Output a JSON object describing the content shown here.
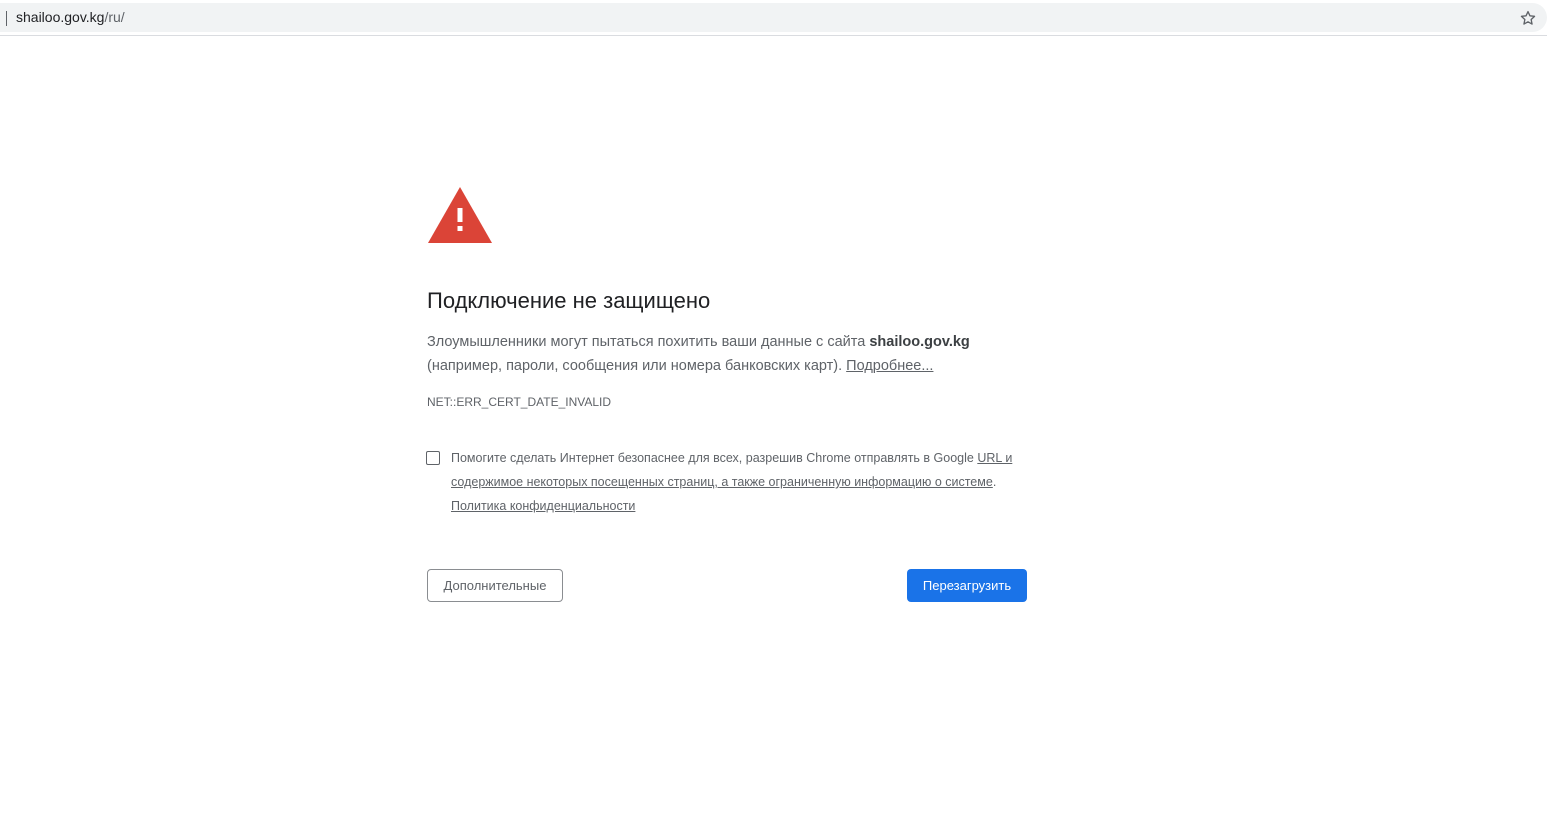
{
  "omnibox": {
    "host": "shailoo.gov.kg",
    "path": "/ru/",
    "bookmark_icon": "star-icon"
  },
  "interstitial": {
    "icon": "warning-triangle-icon",
    "icon_color": "#db4437",
    "heading": "Подключение не защищено",
    "description_prefix": "Злоумышленники могут пытаться похитить ваши данные с сайта ",
    "description_host": "shailoo.gov.kg",
    "description_suffix": " (например, пароли, сообщения или номера банковских карт). ",
    "learn_more_link": "Подробнее...",
    "error_code": "NET::ERR_CERT_DATE_INVALID",
    "optin": {
      "checked": false,
      "text_prefix": "Помогите сделать Интернет безопаснее для всех, разрешив Chrome отправлять в Google ",
      "data_link": "URL и содержимое некоторых посещенных страниц, а также ограниченную информацию о системе",
      "separator": ". ",
      "privacy_link": "Политика конфиденциальности"
    },
    "buttons": {
      "advanced": "Дополнительные",
      "reload": "Перезагрузить"
    },
    "primary_color": "#1a73e8"
  }
}
